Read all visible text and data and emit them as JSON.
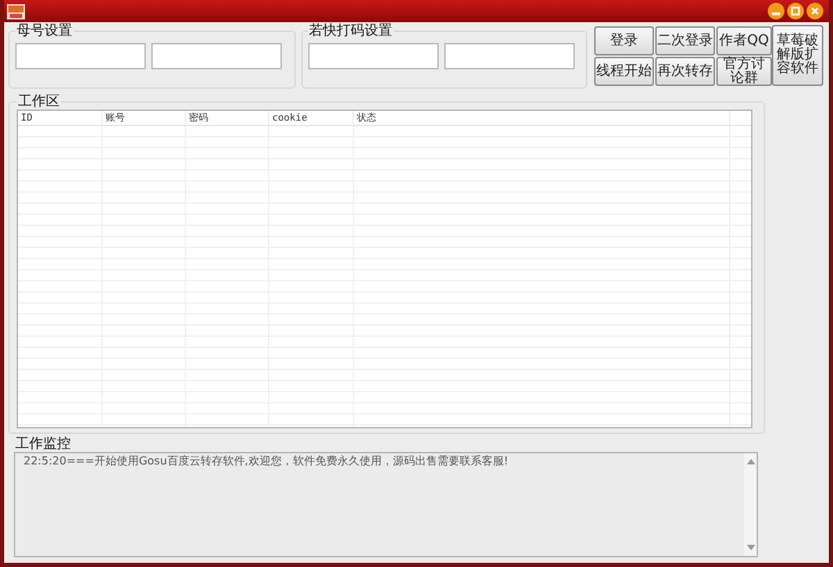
{
  "groups": [
    {
      "title": "母号设置",
      "fields": [
        {
          "kind": "text"
        },
        {
          "kind": "text"
        }
      ]
    },
    {
      "title": "若快打码设置",
      "fields": [
        {
          "kind": "text"
        },
        {
          "kind": "text"
        }
      ]
    }
  ],
  "buttons": [
    {
      "label": "登录"
    },
    {
      "label": "二次登录"
    },
    {
      "label": "作者QQ"
    },
    {
      "label": "线程开始"
    },
    {
      "label": "再次转存"
    },
    {
      "label": "官方讨论群"
    }
  ],
  "side_button": {
    "label": "草莓破解版扩容软件"
  },
  "work_area": {
    "title": "工作区",
    "columns": [
      "ID",
      "账号",
      "密码",
      "cookie",
      "状态"
    ]
  },
  "monitor": {
    "title": "工作监控",
    "log": "22:5:20===开始使用Gosu百度云转存软件,欢迎您，软件免费永久使用，源码出售需要联系客服!"
  }
}
